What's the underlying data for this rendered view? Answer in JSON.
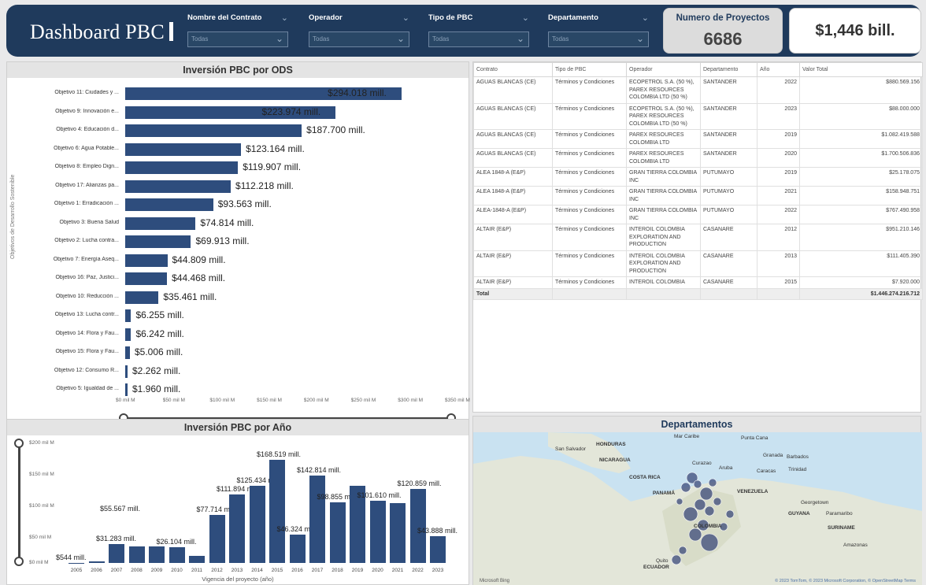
{
  "header": {
    "title": "Dashboard PBC",
    "filters": [
      {
        "label": "Nombre del Contrato",
        "value": "Todas"
      },
      {
        "label": "Operador",
        "value": "Todas"
      },
      {
        "label": "Tipo de PBC",
        "value": "Todas"
      },
      {
        "label": "Departamento",
        "value": "Todas"
      }
    ],
    "kpi_projects_label": "Numero de Proyectos",
    "kpi_projects_value": "6686",
    "kpi_total_value": "$1,446 bill."
  },
  "ods_chart": {
    "title": "Inversión PBC por ODS",
    "ylabel": "Objetivos de Desarrollo Sostenible",
    "x_ticks": [
      "$0 mil M",
      "$50 mil M",
      "$100 mil M",
      "$150 mil M",
      "$200 mil M",
      "$250 mil M",
      "$300 mil M",
      "$350 mil M"
    ]
  },
  "year_chart": {
    "title": "Inversión PBC por Año",
    "y_ticks": [
      "$200 mil M",
      "$150 mil M",
      "$100 mil M",
      "$50 mil M",
      "$0 mil M"
    ],
    "xlabel": "Vigencia del proyecto (año)"
  },
  "chart_data": [
    {
      "type": "bar",
      "orientation": "horizontal",
      "title": "Inversión PBC por ODS",
      "ylabel": "Objetivos de Desarrollo Sostenible",
      "xlim": [
        0,
        350000
      ],
      "categories": [
        "Objetivo 11: Ciudades y ...",
        "Objetivo 9: Innovación e...",
        "Objetivo 4: Educación d...",
        "Objetivo 6: Agua Potable...",
        "Objetivo 8: Empleo Dign...",
        "Objetivo 17: Alianzas pa...",
        "Objetivo 1: Erradicación ...",
        "Objetivo 3: Buena Salud",
        "Objetivo 2: Lucha contra...",
        "Objetivo 7: Energía Aseq...",
        "Objetivo 16: Paz, Justici...",
        "Objetivo 10: Reducción ...",
        "Objetivo 13: Lucha contr...",
        "Objetivo 14: Flora y Fau...",
        "Objetivo 15: Flora y Fau...",
        "Objetivo 12: Consumo R...",
        "Objetivo 5: Igualdad de ..."
      ],
      "values": [
        294018,
        223974,
        187700,
        123164,
        119907,
        112218,
        93563,
        74814,
        69913,
        44809,
        44468,
        35461,
        6255,
        6242,
        5006,
        2262,
        1960
      ],
      "labels": [
        "$294.018 mill.",
        "$223.974 mill.",
        "$187.700 mill.",
        "$123.164 mill.",
        "$119.907 mill.",
        "$112.218 mill.",
        "$93.563 mill.",
        "$74.814 mill.",
        "$69.913 mill.",
        "$44.809 mill.",
        "$44.468 mill.",
        "$35.461 mill.",
        "$6.255 mill.",
        "$6.242 mill.",
        "$5.006 mill.",
        "$2.262 mill.",
        "$1.960 mill."
      ]
    },
    {
      "type": "bar",
      "title": "Inversión PBC por Año",
      "xlabel": "Vigencia del proyecto (año)",
      "ylim": [
        0,
        200000
      ],
      "categories": [
        "2005",
        "2006",
        "2007",
        "2008",
        "2009",
        "2010",
        "2011",
        "2012",
        "2013",
        "2014",
        "2015",
        "2016",
        "2017",
        "2018",
        "2019",
        "2020",
        "2021",
        "2022",
        "2023"
      ],
      "values": [
        544,
        3000,
        31283,
        27000,
        27500,
        26104,
        11000,
        77714,
        111894,
        125434,
        168519,
        46324,
        142814,
        98855,
        126000,
        101610,
        98000,
        120859,
        43888
      ],
      "labels": [
        "$544 mill.",
        "",
        "$31.283 mill.",
        "",
        "",
        "$26.104 mill.",
        "",
        "$77.714 mill.",
        "$111.894 mill.",
        "$125.434 mill.",
        "$168.519 mill.",
        "$46.324 mill.",
        "$142.814 mill.",
        "$98.855 mill.",
        "",
        "$101.610 mill.",
        "",
        "$120.859 mill.",
        "$43.888 mill."
      ],
      "extra_labels": [
        "$55.567 mill."
      ]
    }
  ],
  "table": {
    "columns": [
      "Contrato",
      "Tipo de PBC",
      "Operador",
      "Departamento",
      "Año",
      "Valor Total"
    ],
    "rows": [
      [
        "AGUAS BLANCAS (CE)",
        "Términos y Condiciones",
        "ECOPETROL S.A. (50 %), PAREX RESOURCES COLOMBIA LTD (50 %)",
        "SANTANDER",
        "2022",
        "$880.569.156"
      ],
      [
        "AGUAS BLANCAS (CE)",
        "Términos y Condiciones",
        "ECOPETROL S.A. (50 %), PAREX RESOURCES COLOMBIA LTD (50 %)",
        "SANTANDER",
        "2023",
        "$88.000.000"
      ],
      [
        "AGUAS BLANCAS (CE)",
        "Términos y Condiciones",
        "PAREX RESOURCES COLOMBIA LTD",
        "SANTANDER",
        "2019",
        "$1.082.419.588"
      ],
      [
        "AGUAS BLANCAS (CE)",
        "Términos y Condiciones",
        "PAREX RESOURCES COLOMBIA LTD",
        "SANTANDER",
        "2020",
        "$1.700.506.836"
      ],
      [
        "ALEA 1848-A (E&P)",
        "Términos y Condiciones",
        "GRAN TIERRA COLOMBIA INC",
        "PUTUMAYO",
        "2019",
        "$25.178.075"
      ],
      [
        "ALEA 1848-A (E&P)",
        "Términos y Condiciones",
        "GRAN TIERRA COLOMBIA INC",
        "PUTUMAYO",
        "2021",
        "$158.948.751"
      ],
      [
        "ALEA-1848-A (E&P)",
        "Términos y Condiciones",
        "GRAN TIERRA COLOMBIA INC",
        "PUTUMAYO",
        "2022",
        "$767.490.958"
      ],
      [
        "ALTAIR (E&P)",
        "Términos y Condiciones",
        "INTEROIL COLOMBIA EXPLORATION AND PRODUCTION",
        "CASANARE",
        "2012",
        "$951.210.146"
      ],
      [
        "ALTAIR (E&P)",
        "Términos y Condiciones",
        "INTEROIL COLOMBIA EXPLORATION AND PRODUCTION",
        "CASANARE",
        "2013",
        "$111.405.390"
      ],
      [
        "ALTAIR (E&P)",
        "Términos y Condiciones",
        "INTEROIL COLOMBIA",
        "CASANARE",
        "2015",
        "$7.920.000"
      ]
    ],
    "total_label": "Total",
    "total_value": "$1.446.274.216.712"
  },
  "map": {
    "title": "Departamentos",
    "labels": [
      "Mar Caribe",
      "Punta Cana",
      "San Salvador",
      "HONDURAS",
      "NICARAGUA",
      "Curazao",
      "Granada",
      "Barbados",
      "Aruba",
      "Caracas",
      "Trinidad",
      "COSTA RICA",
      "PANAMÁ",
      "VENEZUELA",
      "Georgetown",
      "GUYANA",
      "Paramaribo",
      "SURINAME",
      "COLOMBIA",
      "Quito",
      "ECUADOR",
      "Amazonas"
    ],
    "footer": "© 2023 TomTom, © 2023 Microsoft Corporation, © OpenStreetMap Terms",
    "logo": "Microsoft Bing"
  }
}
